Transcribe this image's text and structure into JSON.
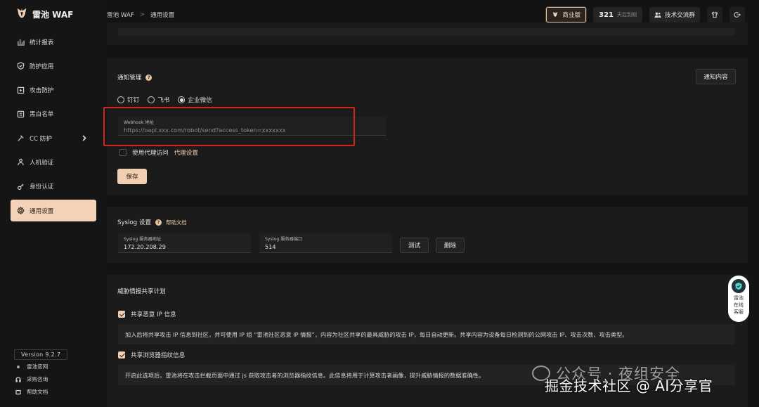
{
  "brand": {
    "name": "雷池 WAF"
  },
  "breadcrumb": {
    "root": "雷池 WAF",
    "separator": ">",
    "current": "通用设置"
  },
  "topbar": {
    "edition": "商业版",
    "days_left": "321",
    "days_label": "天后到期",
    "group_label": "技术交流群"
  },
  "sidebar": {
    "items": [
      {
        "label": "统计报表",
        "icon": "bar-chart-icon"
      },
      {
        "label": "防护应用",
        "icon": "shield-icon"
      },
      {
        "label": "攻击防护",
        "icon": "attack-icon"
      },
      {
        "label": "黑白名单",
        "icon": "list-icon"
      },
      {
        "label": "CC 防护",
        "icon": "cc-icon"
      },
      {
        "label": "人机验证",
        "icon": "person-icon"
      },
      {
        "label": "身份认证",
        "icon": "key-icon"
      },
      {
        "label": "通用设置",
        "icon": "gear-icon"
      }
    ],
    "version": "Version 9.2.7",
    "links": {
      "official": "雷池官网",
      "purchase": "采购咨询",
      "docs": "帮助文档"
    }
  },
  "notify": {
    "title": "通知管理",
    "content_button": "通知内容",
    "options": [
      "钉钉",
      "飞书",
      "企业微信"
    ],
    "selected": "企业微信",
    "webhook_label": "Webhook 地址",
    "webhook_placeholder": "https://oapi.xxx.com/robot/send?access_token=xxxxxxx",
    "proxy_label": "使用代理访问",
    "proxy_link": "代理设置",
    "save": "保存"
  },
  "syslog": {
    "title": "Syslog 设置",
    "help": "帮助文档",
    "addr_label": "Syslog 服务器地址",
    "addr_value": "172.20.208.29",
    "port_label": "Syslog 服务器端口",
    "port_value": "514",
    "test": "测试",
    "delete": "删除"
  },
  "threat": {
    "title": "威胁情报共享计划",
    "ip_label": "共享恶意 IP 信息",
    "ip_desc": "加入后将共享攻击 IP 信息到社区，并可使用 IP 组 “雷池社区恶意 IP 情报”，内容为社区共享的最具威胁的攻击 IP，每日自动更新。共享内容为设备每日检测到的公网攻击 IP、攻击次数、攻击类型。",
    "fp_label": "共享浏览器指纹信息",
    "fp_desc": "开启此选项后，雷池将在攻击拦截页面中通过 js 获取攻击者的浏览器指纹信息。此信息将用于计算攻击者画像，提升威胁情报的数据准确性。"
  },
  "support": {
    "line1": "雷池",
    "line2": "在线",
    "line3": "客服"
  },
  "watermark": {
    "line1": "公众号 · 夜组安全",
    "line2": "掘金技术社区 @ AI分享官"
  }
}
